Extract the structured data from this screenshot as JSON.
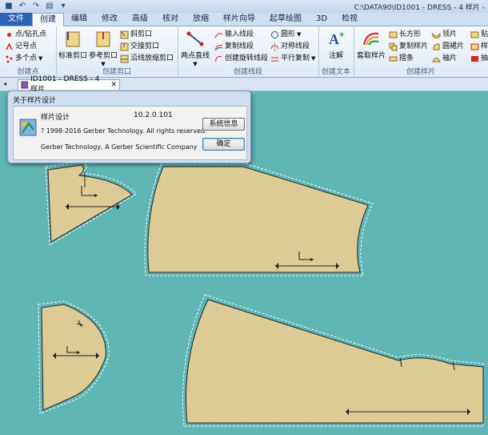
{
  "window": {
    "title": "C:\\DATA90\\ID1001 - DRESS - 4 样片 -"
  },
  "ribbon_tabs": [
    "文件",
    "创建",
    "编辑",
    "修改",
    "高级",
    "核对",
    "放缩",
    "样片向导",
    "起草绘图",
    "3D",
    "检视"
  ],
  "ribbon": {
    "create_point": {
      "label": "创建点",
      "items": [
        "点/钻孔点",
        "记号点",
        "多个点"
      ]
    },
    "create_notch": {
      "label": "创建剪口",
      "big1": "标准剪口",
      "big2": "参考剪口",
      "items": [
        "斜剪口",
        "交接剪口",
        "沿线放缩剪口"
      ]
    },
    "create_line": {
      "label": "创建线段",
      "big": "两点直线",
      "col1": [
        "输入线段",
        "复制线段",
        "创建旋转线段"
      ],
      "col2": [
        "圆形",
        "对称线段",
        "平行复制"
      ]
    },
    "create_text": {
      "label": "创建文本",
      "big": "注解"
    },
    "create_piece": {
      "label": "创建样片",
      "big": "套取样片",
      "col1": [
        "长方形",
        "复制样片",
        "摺条"
      ],
      "col2": [
        "领片",
        "圆裙片",
        "袖片"
      ],
      "col3": [
        "贴边",
        "样片",
        "抽取"
      ]
    }
  },
  "doc_tab": {
    "label": "ID1001 - DRESS - 4 样片"
  },
  "dialog": {
    "title": "关于样片设计",
    "product": "样片设计",
    "version": "10.2.0.101",
    "copyright": "? 1998-2016 Gerber Technology. All rights reserved.",
    "company": "Gerber Technology, A Gerber Scientific Company",
    "sysinfo_button": "系统信息",
    "ok_button": "确定"
  },
  "colors": {
    "canvas_bg": "#5fb4b4",
    "piece_fill": "#dccb94",
    "ribbon_accent": "#2b62b8"
  }
}
